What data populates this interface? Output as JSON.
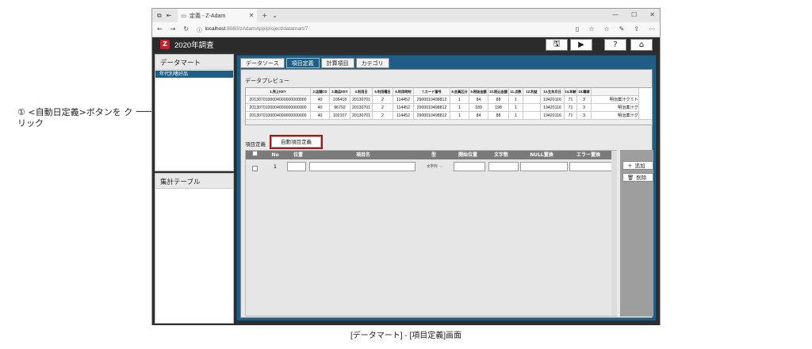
{
  "annotation": {
    "text": "① <自動日定義>ボタンを クリック"
  },
  "browser": {
    "tab_title": "定義 - Z-Adam",
    "url_host": "localhost",
    "url_path": ":8080/zAdamApp/project/datamart/7"
  },
  "app": {
    "title": "2020年調査",
    "logo": "logo-z"
  },
  "sidebar": {
    "datamart_header": "データマート",
    "datamart_item": "年代別嗜好品",
    "aggregate_header": "集計テーブル"
  },
  "tabs": [
    "データソース",
    "項目定義",
    "計算項目",
    "カテゴリ"
  ],
  "active_tab": "項目定義",
  "preview": {
    "label": "データプレビュー",
    "headers": [
      "1.売上KEY",
      "2.店舗CD",
      "3.商品KEY",
      "4.利用日",
      "5.利用曜日",
      "6.利用時刻",
      "7.カード番号",
      "8.会員区分",
      "9.税抜金額",
      "10.税込金額",
      "11.点数",
      "12.利益",
      "13.生年月日",
      "14.年齢",
      "15.職域"
    ],
    "rows": [
      [
        "2013070100004000000000000",
        "40",
        "105418",
        "20130701",
        "2",
        "114452",
        "2900010498812",
        "1",
        "84",
        "88",
        "1",
        "",
        "19420116",
        "71",
        "3",
        "明治薬汁グミト"
      ],
      [
        "2013070100004000000000000",
        "40",
        "96792",
        "20130701",
        "2",
        "114452",
        "2900010498812",
        "1",
        "189",
        "198",
        "1",
        "",
        "19420116",
        "71",
        "3",
        "明治薬汁グ"
      ],
      [
        "2013070100004000000000000",
        "40",
        "102107",
        "20130701",
        "2",
        "114452",
        "2900010498812",
        "1",
        "84",
        "88",
        "1",
        "",
        "19420116",
        "71",
        "3",
        "明治薬汁グ"
      ]
    ]
  },
  "definition": {
    "label": "項目定義",
    "auto_button": "自動項目定義",
    "headers": [
      "No",
      "位置",
      "項目名",
      "型",
      "開始位置",
      "文字数",
      "NULL置換",
      "エラー置換"
    ],
    "row": {
      "no": "1",
      "type": "文字列"
    },
    "add_button": "追加",
    "delete_button": "削除"
  },
  "caption": "[データマート] - [項目定義]画面"
}
